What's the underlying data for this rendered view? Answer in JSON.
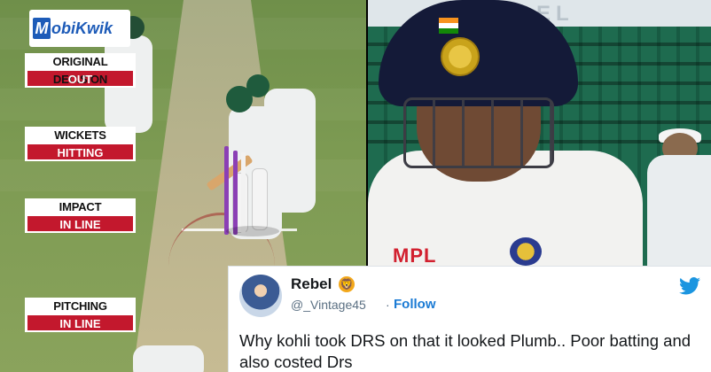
{
  "drs_graphic": {
    "sponsor_logo_letter": "M",
    "sponsor_logo_text": "obiKwik",
    "rows": [
      {
        "label": "ORIGINAL DECISION",
        "value": "OUT"
      },
      {
        "label": "WICKETS",
        "value": "HITTING"
      },
      {
        "label": "IMPACT",
        "value": "IN LINE"
      },
      {
        "label": "PITCHING",
        "value": "IN LINE"
      }
    ]
  },
  "photo": {
    "banner_text": "AACEL",
    "shirt_sponsor": "MPL"
  },
  "tweet": {
    "display_name": "Rebel",
    "emoji": "🦁",
    "handle": "@_Vintage45",
    "separator": "·",
    "follow_label": "Follow",
    "text": "Why kohli took DRS on that it looked Plumb.. Poor batting and also costed  Drs"
  },
  "icons": {
    "twitter_bird": "twitter-bird-icon",
    "verified_emoji": "lion-emoji-icon"
  },
  "colors": {
    "drs_red": "#c3182d",
    "twitter_blue": "#1b95e0",
    "follow_blue": "#1b7bd4"
  }
}
